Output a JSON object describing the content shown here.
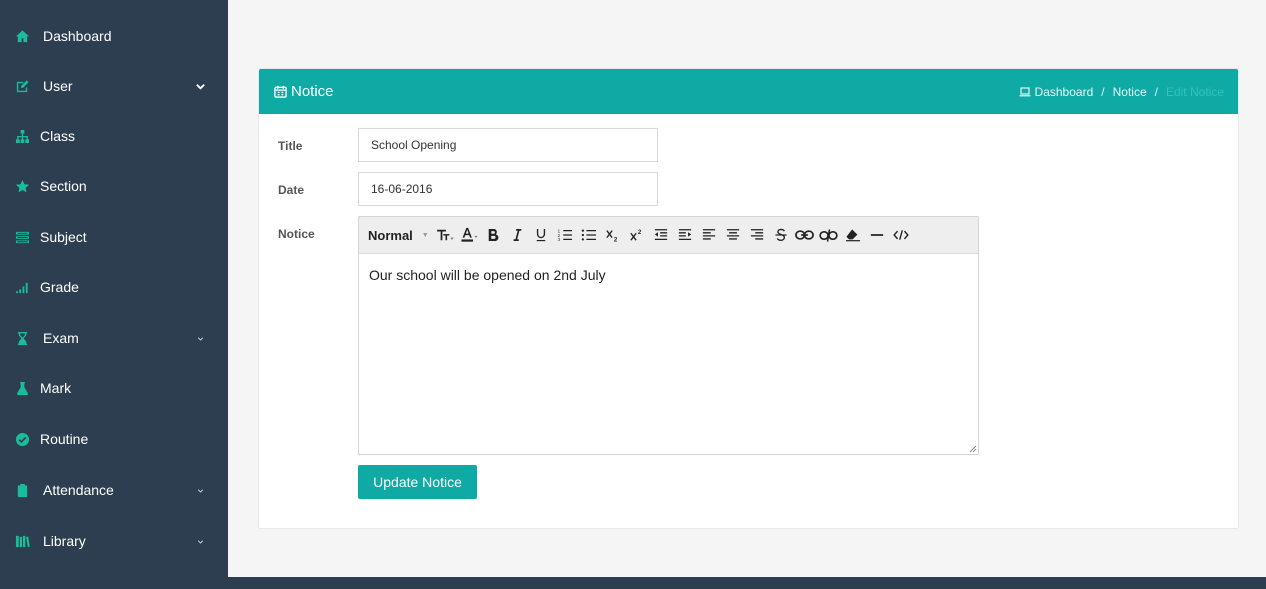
{
  "sidebar": {
    "items": [
      {
        "label": "Dashboard",
        "icon": "home-icon"
      },
      {
        "label": "User",
        "icon": "edit-icon",
        "expandable": true
      },
      {
        "label": "Class",
        "icon": "sitemap-icon"
      },
      {
        "label": "Section",
        "icon": "star-icon"
      },
      {
        "label": "Subject",
        "icon": "book-icon"
      },
      {
        "label": "Grade",
        "icon": "signal-icon"
      },
      {
        "label": "Exam",
        "icon": "hourglass-icon",
        "expandable": true
      },
      {
        "label": "Mark",
        "icon": "flask-icon"
      },
      {
        "label": "Routine",
        "icon": "check-circle-icon"
      },
      {
        "label": "Attendance",
        "icon": "clipboard-icon",
        "expandable": true
      },
      {
        "label": "Library",
        "icon": "books-icon",
        "expandable": true
      }
    ]
  },
  "panel": {
    "title": "Notice",
    "breadcrumb": [
      "Dashboard",
      "Notice",
      "Edit Notice"
    ]
  },
  "form": {
    "title_label": "Title",
    "title_value": "School Opening",
    "date_label": "Date",
    "date_value": "16-06-2016",
    "notice_label": "Notice",
    "editor_style": "Normal",
    "notice_text": "Our school will be opened on 2nd July",
    "submit_label": "Update Notice"
  },
  "colors": {
    "sidebar_bg": "#2c3e50",
    "accent": "#10aaa5",
    "icon_color": "#1abc9c"
  }
}
